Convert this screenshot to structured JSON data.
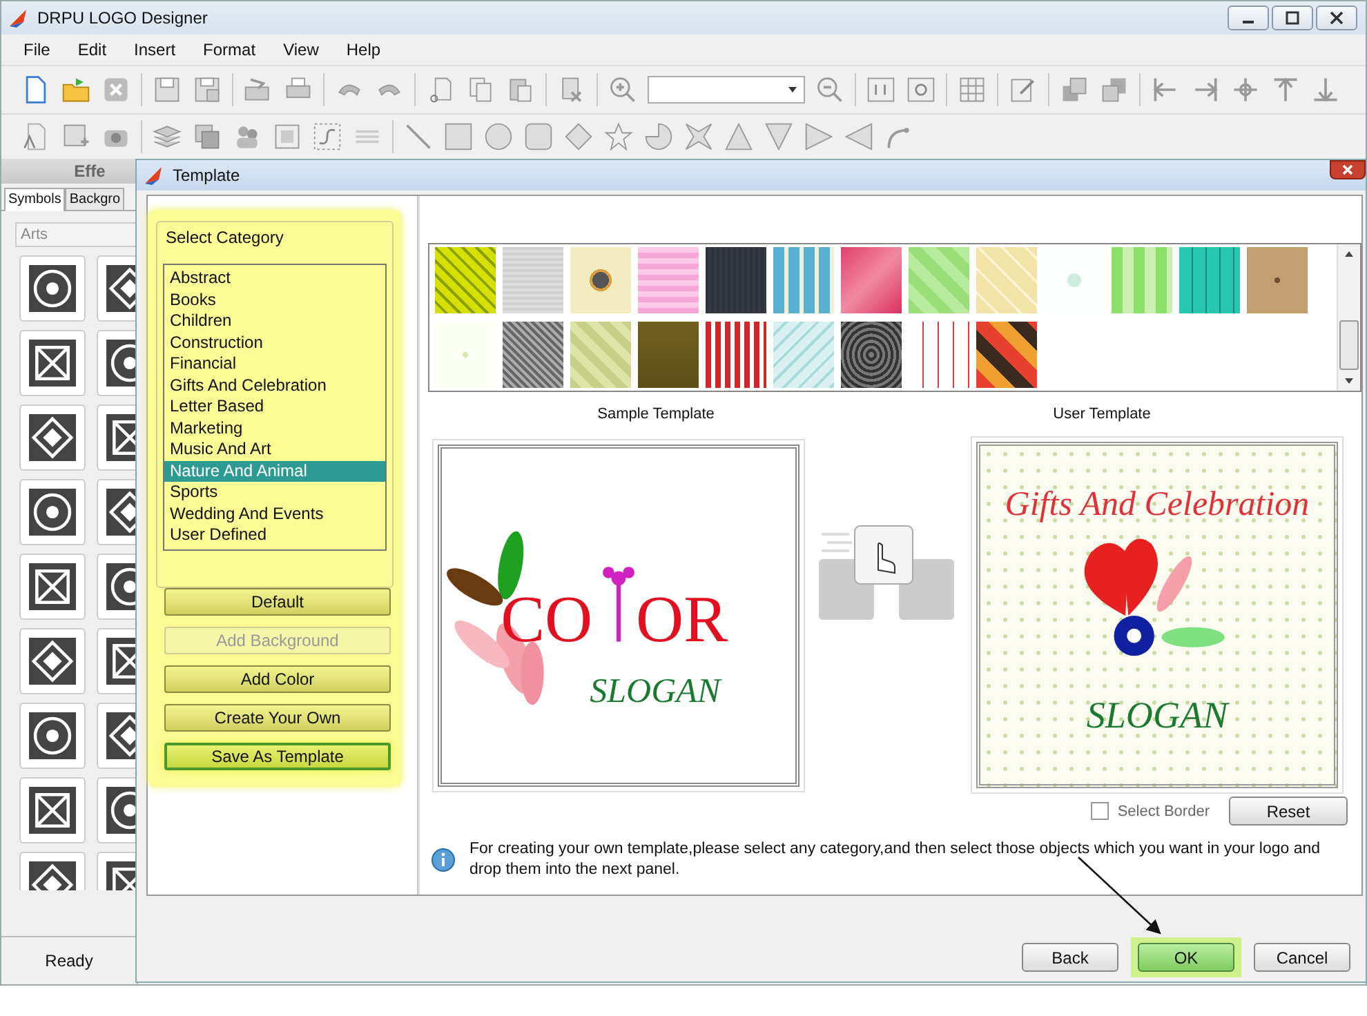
{
  "app": {
    "title": "DRPU LOGO Designer"
  },
  "menu": [
    "File",
    "Edit",
    "Insert",
    "Format",
    "View",
    "Help"
  ],
  "side_panel": {
    "title": "Effe",
    "tabs": [
      {
        "label": "Symbols",
        "selected": true
      },
      {
        "label": "Backgro",
        "selected": false
      }
    ],
    "filter": "Arts"
  },
  "status_bar": {
    "text": "Ready"
  },
  "dialog": {
    "title": "Template",
    "category_group": {
      "title": "Select Category",
      "items": [
        {
          "label": "Abstract",
          "selected": false
        },
        {
          "label": "Books",
          "selected": false
        },
        {
          "label": "Children",
          "selected": false
        },
        {
          "label": "Construction",
          "selected": false
        },
        {
          "label": "Financial",
          "selected": false
        },
        {
          "label": "Gifts And Celebration",
          "selected": false
        },
        {
          "label": "Letter Based",
          "selected": false
        },
        {
          "label": "Marketing",
          "selected": false
        },
        {
          "label": "Music And Art",
          "selected": false
        },
        {
          "label": "Nature And Animal",
          "selected": true
        },
        {
          "label": "Sports",
          "selected": false
        },
        {
          "label": "Wedding And Events",
          "selected": false
        },
        {
          "label": "User Defined",
          "selected": false
        }
      ]
    },
    "buttons": [
      {
        "label": "Default",
        "disabled": false,
        "highlighted": false
      },
      {
        "label": "Add Background",
        "disabled": true,
        "highlighted": false
      },
      {
        "label": "Add Color",
        "disabled": false,
        "highlighted": false
      },
      {
        "label": "Create Your Own",
        "disabled": false,
        "highlighted": false
      },
      {
        "label": "Save As Template",
        "disabled": false,
        "highlighted": true
      }
    ],
    "sample_caption": "Sample Template",
    "user_caption": "User Template",
    "sample_logo": {
      "word_start": "CO",
      "word_end": "OR",
      "slogan": "SLOGAN"
    },
    "user_logo": {
      "heading": "Gifts And Celebration",
      "slogan": "SLOGAN"
    },
    "select_border": {
      "label": "Select Border",
      "checked": false
    },
    "reset": "Reset",
    "info": "For creating your own template,please select any category,and then select those objects which you want in your logo and drop them into the next panel.",
    "footer_buttons": [
      {
        "label": "Back",
        "highlighted": false
      },
      {
        "label": "OK",
        "highlighted": true
      },
      {
        "label": "Cancel",
        "highlighted": false
      }
    ]
  }
}
